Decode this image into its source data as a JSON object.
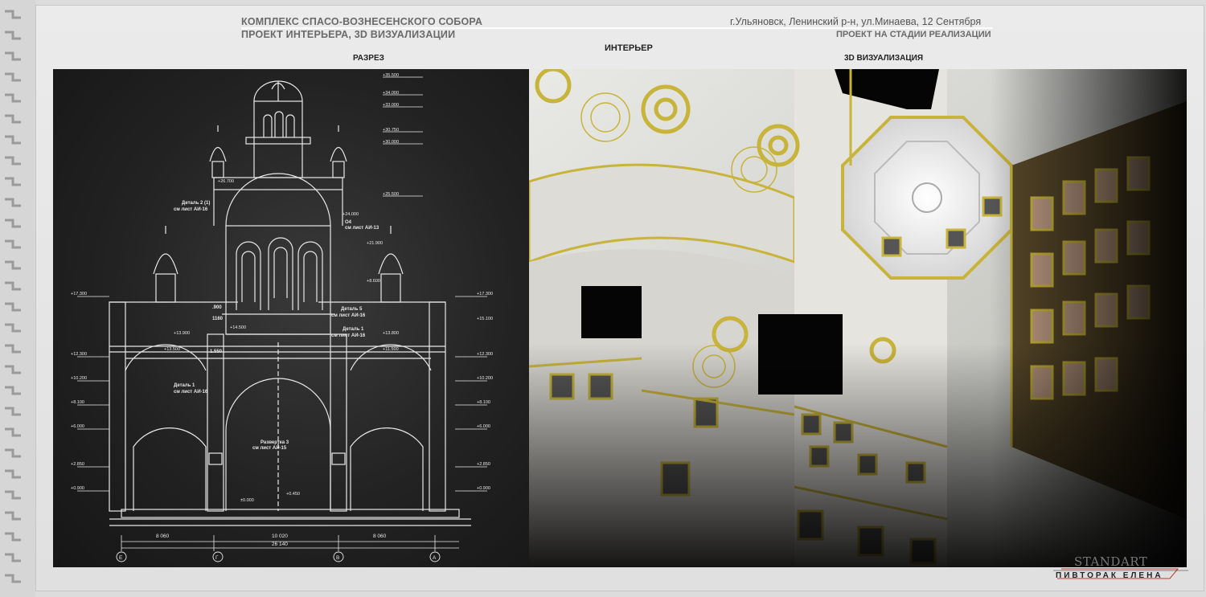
{
  "header": {
    "title_line1": "КОМПЛЕКС СПАСО-ВОЗНЕСЕНСКОГО СОБОРА",
    "title_line2": "ПРОЕКТ ИНТЕРЬЕРА, 3D ВИЗУАЛИЗАЦИИ",
    "location": "г.Ульяновск, Ленинский р-н, ул.Минаева, 12 Сентября",
    "status": "ПРОЕКТ НА СТАДИИ РЕАЛИЗАЦИИ"
  },
  "section_title": "ИНТЕРЬЕР",
  "left_panel": {
    "label": "РАЗРЕЗ",
    "level_marks": [
      "+35.500",
      "+34.000",
      "+33.000",
      "+30.750",
      "+30.000",
      "+25.500",
      "+24.000",
      "+21.900",
      "+26.700",
      "+8.600",
      "+17.300",
      "+17.300",
      "+15.100",
      "+13.900",
      "+14.500",
      "+13.800",
      "+13.500",
      "+11.500",
      "+12.300",
      "+12.300",
      "+10.200",
      "+10.200",
      "+8.100",
      "+8.100",
      "+6.000",
      "+6.000",
      "+2.850",
      "+2.850",
      "+0.900",
      "+0.900",
      "±0.000",
      "+0.450"
    ],
    "notes": [
      {
        "text": "Деталь 2 (1)"
      },
      {
        "text": "см лист АИ-16"
      },
      {
        "text": "О4"
      },
      {
        "text": "см лист АИ-13"
      },
      {
        "text": "Деталь 5"
      },
      {
        "text": "см лист АИ-16"
      },
      {
        "text": "Деталь 1"
      },
      {
        "text": "см лист АИ-16"
      },
      {
        "text": "Деталь 1"
      },
      {
        "text": "см лист АИ-16"
      },
      {
        "text": "Развертка 3"
      },
      {
        "text": "см лист АИ-15"
      },
      {
        "text": "1160"
      },
      {
        "text": "1.550"
      },
      {
        "text": ".900"
      }
    ],
    "dimensions": [
      "8 060",
      "10 020",
      "8 060",
      "26 140"
    ],
    "axes": [
      "Е",
      "Г",
      "В",
      "А"
    ]
  },
  "right_panel": {
    "label": "3D ВИЗУАЛИЗАЦИЯ"
  },
  "brand": {
    "name": "STANDART",
    "author": "ПИВТОРАК ЕЛЕНА"
  },
  "colors": {
    "sheet": "#e6e6e6",
    "drawing_bg": "#222222",
    "drawing_lines": "#e8e8e8",
    "gold": "#c8b43a",
    "brand_red": "#c0392b"
  }
}
